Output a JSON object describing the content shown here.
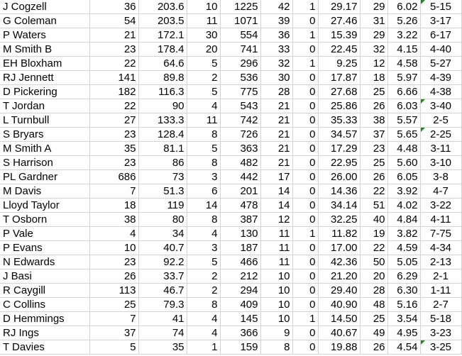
{
  "sheet": {
    "rows": [
      [
        "J Cogzell",
        "36",
        "203.6",
        "10",
        "1225",
        "42",
        "1",
        "29.17",
        "29",
        "6.02",
        "5-15"
      ],
      [
        "G Coleman",
        "54",
        "203.5",
        "11",
        "1071",
        "39",
        "0",
        "27.46",
        "31",
        "5.26",
        "3-17"
      ],
      [
        "P Waters",
        "21",
        "172.1",
        "30",
        "554",
        "36",
        "1",
        "15.39",
        "29",
        "3.22",
        "6-17"
      ],
      [
        "M Smith B",
        "23",
        "178.4",
        "20",
        "741",
        "33",
        "0",
        "22.45",
        "32",
        "4.15",
        "4-40"
      ],
      [
        "EH Bloxham",
        "22",
        "64.6",
        "5",
        "296",
        "32",
        "1",
        "9.25",
        "12",
        "4.58",
        "5-27"
      ],
      [
        "RJ Jennett",
        "141",
        "89.8",
        "2",
        "536",
        "30",
        "0",
        "17.87",
        "18",
        "5.97",
        "4-39"
      ],
      [
        "D Pickering",
        "182",
        "116.3",
        "5",
        "775",
        "28",
        "0",
        "27.68",
        "25",
        "6.66",
        "4-38"
      ],
      [
        "T Jordan",
        "22",
        "90",
        "4",
        "543",
        "21",
        "0",
        "25.86",
        "26",
        "6.03",
        "3-40"
      ],
      [
        "L Turnbull",
        "27",
        "133.3",
        "11",
        "742",
        "21",
        "0",
        "35.33",
        "38",
        "5.57",
        "2-5"
      ],
      [
        "S Bryars",
        "23",
        "128.4",
        "8",
        "726",
        "21",
        "0",
        "34.57",
        "37",
        "5.65",
        "2-25"
      ],
      [
        "M Smith A",
        "35",
        "81.1",
        "5",
        "363",
        "21",
        "0",
        "17.29",
        "23",
        "4.48",
        "3-11"
      ],
      [
        "S Harrison",
        "23",
        "86",
        "8",
        "482",
        "21",
        "0",
        "22.95",
        "25",
        "5.60",
        "3-10"
      ],
      [
        "PL Gardner",
        "686",
        "73",
        "3",
        "442",
        "17",
        "0",
        "26.00",
        "26",
        "6.05",
        "3-8"
      ],
      [
        "M Davis",
        "7",
        "51.3",
        "6",
        "201",
        "14",
        "0",
        "14.36",
        "22",
        "3.92",
        "4-7"
      ],
      [
        "Lloyd Taylor",
        "18",
        "119",
        "14",
        "478",
        "14",
        "0",
        "34.14",
        "51",
        "4.02",
        "3-22"
      ],
      [
        "T Osborn",
        "38",
        "80",
        "8",
        "387",
        "12",
        "0",
        "32.25",
        "40",
        "4.84",
        "4-11"
      ],
      [
        "P Vale",
        "4",
        "34",
        "4",
        "130",
        "11",
        "1",
        "11.82",
        "19",
        "3.82",
        "7-75"
      ],
      [
        "P Evans",
        "10",
        "40.7",
        "3",
        "187",
        "11",
        "0",
        "17.00",
        "22",
        "4.59",
        "4-34"
      ],
      [
        "N Edwards",
        "23",
        "92.2",
        "5",
        "466",
        "11",
        "0",
        "42.36",
        "50",
        "5.05",
        "2-13"
      ],
      [
        "J Basi",
        "26",
        "33.7",
        "2",
        "212",
        "10",
        "0",
        "21.20",
        "20",
        "6.29",
        "2-1"
      ],
      [
        "R Caygill",
        "113",
        "46.7",
        "2",
        "294",
        "10",
        "0",
        "29.40",
        "28",
        "6.30",
        "1-11"
      ],
      [
        "C Collins",
        "25",
        "79.3",
        "8",
        "409",
        "10",
        "0",
        "40.90",
        "48",
        "5.16",
        "2-7"
      ],
      [
        "D Hemmings",
        "7",
        "41",
        "4",
        "145",
        "10",
        "1",
        "14.50",
        "25",
        "3.54",
        "5-18"
      ],
      [
        "RJ Ings",
        "37",
        "74",
        "4",
        "366",
        "9",
        "0",
        "40.67",
        "49",
        "4.95",
        "3-23"
      ],
      [
        "T Davies",
        "5",
        "35",
        "1",
        "159",
        "8",
        "0",
        "19.88",
        "26",
        "4.54",
        "3-25"
      ]
    ],
    "text_warning_rows": [
      0,
      7,
      9,
      24
    ],
    "warning_color": "#1e8a1e",
    "gridline_color": "#d4d4d4"
  }
}
